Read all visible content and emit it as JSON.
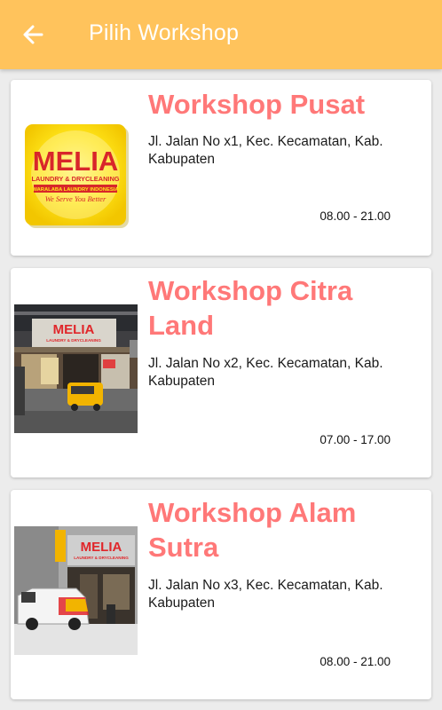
{
  "appbar": {
    "title": "Pilih Workshop",
    "back_icon": "arrow-left-icon",
    "background": "#ffc35c"
  },
  "workshops": [
    {
      "name": "Workshop Pusat",
      "address": "Jl. Jalan No x1, Kec. Kecamatan, Kab. Kabupaten",
      "hours": "08.00 - 21.00",
      "image": "melia-logo",
      "logo": {
        "brand": "MELIA",
        "line1": "LAUNDRY & DRYCLEANING",
        "line2": "WARALABA LAUNDRY INDONESIA",
        "slogan": "We Serve You Better"
      }
    },
    {
      "name": "Workshop Citra Land",
      "address": "Jl. Jalan No x2, Kec. Kecamatan, Kab. Kabupaten",
      "hours": "07.00 - 17.00",
      "image": "storefront-photo",
      "sign": {
        "brand": "MELIA",
        "line1": "LAUNDRY & DRYCLEANING"
      }
    },
    {
      "name": "Workshop Alam Sutra",
      "address": "Jl. Jalan No x3, Kec. Kecamatan, Kab. Kabupaten",
      "hours": "08.00 - 21.00",
      "image": "storefront-van-photo",
      "sign": {
        "brand": "MELIA",
        "line1": "LAUNDRY & DRYCLEANING"
      }
    }
  ],
  "colors": {
    "accent": "#ffc35c",
    "title_text": "#ff7878",
    "brand_red": "#d8262a",
    "brand_yellow": "#ffe51a"
  }
}
